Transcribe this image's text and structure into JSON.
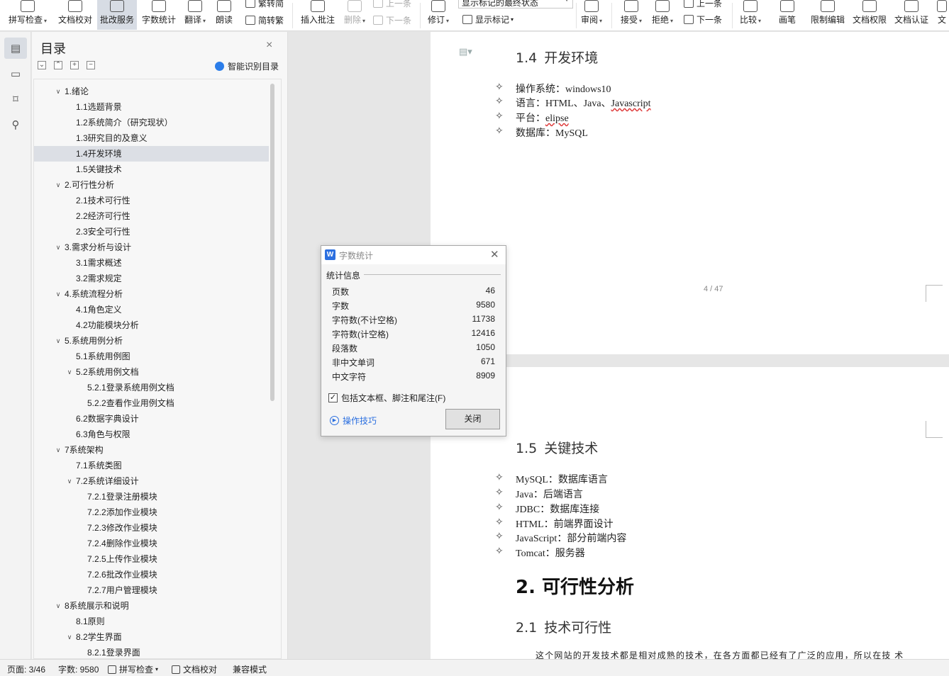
{
  "ribbon": {
    "buttons": [
      {
        "label": "拼写检查",
        "caret": "▾"
      },
      {
        "label": "文档校对",
        "caret": ""
      },
      {
        "label": "批改服务",
        "caret": ""
      },
      {
        "label": "字数统计",
        "caret": ""
      },
      {
        "label": "翻译",
        "caret": "▾"
      },
      {
        "label": "朗读",
        "caret": ""
      },
      {
        "label": "插入批注",
        "caret": ""
      },
      {
        "label": "删除",
        "caret": "▾"
      },
      {
        "label": "修订",
        "caret": "▾"
      },
      {
        "label": "审阅",
        "caret": "▾"
      },
      {
        "label": "接受",
        "caret": "▾"
      },
      {
        "label": "拒绝",
        "caret": "▾"
      },
      {
        "label": "比较",
        "caret": "▾"
      },
      {
        "label": "画笔",
        "caret": ""
      },
      {
        "label": "限制编辑",
        "caret": ""
      },
      {
        "label": "文档权限",
        "caret": ""
      },
      {
        "label": "文档认证",
        "caret": ""
      },
      {
        "label": "文",
        "caret": ""
      }
    ],
    "trad_simplified": "繁转简",
    "simplified_trad": "简转繁",
    "prev_comment": "上一条",
    "next_comment": "下一条",
    "markup_state": "显示标记的最终状态",
    "show_markup": "显示标记",
    "prev_change": "上一条",
    "next_change": "下一条"
  },
  "sidebar_icons": [
    "outline-icon",
    "navigation-icon",
    "bookmark-icon",
    "search-icon"
  ],
  "toc": {
    "title": "目录",
    "close": "×",
    "smart": "智能识别目录",
    "items": [
      {
        "label": "1.绪论",
        "level": 1,
        "arrow": "v"
      },
      {
        "label": "1.1选题背景",
        "level": 2,
        "arrow": ""
      },
      {
        "label": "1.2系统简介（研究现状）",
        "level": 2,
        "arrow": ""
      },
      {
        "label": "1.3研究目的及意义",
        "level": 2,
        "arrow": ""
      },
      {
        "label": "1.4开发环境",
        "level": 2,
        "arrow": "",
        "selected": true
      },
      {
        "label": "1.5关键技术",
        "level": 2,
        "arrow": ""
      },
      {
        "label": "2.可行性分析",
        "level": 1,
        "arrow": "v"
      },
      {
        "label": "2.1技术可行性",
        "level": 2,
        "arrow": ""
      },
      {
        "label": "2.2经济可行性",
        "level": 2,
        "arrow": ""
      },
      {
        "label": "2.3安全可行性",
        "level": 2,
        "arrow": ""
      },
      {
        "label": "3.需求分析与设计",
        "level": 1,
        "arrow": "v"
      },
      {
        "label": "3.1需求概述",
        "level": 2,
        "arrow": ""
      },
      {
        "label": "3.2需求规定",
        "level": 2,
        "arrow": ""
      },
      {
        "label": "4.系统流程分析",
        "level": 1,
        "arrow": "v"
      },
      {
        "label": "4.1角色定义",
        "level": 2,
        "arrow": ""
      },
      {
        "label": "4.2功能模块分析",
        "level": 2,
        "arrow": ""
      },
      {
        "label": "5.系统用例分析",
        "level": 1,
        "arrow": "v"
      },
      {
        "label": "5.1系统用例图",
        "level": 2,
        "arrow": ""
      },
      {
        "label": "5.2系统用例文档",
        "level": 2,
        "arrow": "v"
      },
      {
        "label": "5.2.1登录系统用例文档",
        "level": 3,
        "arrow": ""
      },
      {
        "label": "5.2.2查看作业用例文档",
        "level": 3,
        "arrow": ""
      },
      {
        "label": "6.2数据字典设计",
        "level": 2,
        "arrow": ""
      },
      {
        "label": "6.3角色与权限",
        "level": 2,
        "arrow": ""
      },
      {
        "label": "7系统架构",
        "level": 1,
        "arrow": "v"
      },
      {
        "label": "7.1系统类图",
        "level": 2,
        "arrow": ""
      },
      {
        "label": "7.2系统详细设计",
        "level": 2,
        "arrow": "v"
      },
      {
        "label": "7.2.1登录注册模块",
        "level": 3,
        "arrow": ""
      },
      {
        "label": "7.2.2添加作业模块",
        "level": 3,
        "arrow": ""
      },
      {
        "label": "7.2.3修改作业模块",
        "level": 3,
        "arrow": ""
      },
      {
        "label": "7.2.4删除作业模块",
        "level": 3,
        "arrow": ""
      },
      {
        "label": "7.2.5上传作业模块",
        "level": 3,
        "arrow": ""
      },
      {
        "label": "7.2.6批改作业模块",
        "level": 3,
        "arrow": ""
      },
      {
        "label": "7.2.7用户管理模块",
        "level": 3,
        "arrow": ""
      },
      {
        "label": "8系统展示和说明",
        "level": 1,
        "arrow": "v"
      },
      {
        "label": "8.1原则",
        "level": 2,
        "arrow": ""
      },
      {
        "label": "8.2学生界面",
        "level": 2,
        "arrow": "v"
      },
      {
        "label": "8.2.1登录界面",
        "level": 3,
        "arrow": ""
      }
    ]
  },
  "page1": {
    "heading_num": "1.4",
    "heading_text": "开发环境",
    "bullets": [
      {
        "label": "操作系统",
        "value": "windows10",
        "wavy": ""
      },
      {
        "label": "语言",
        "value": "HTML、Java、",
        "wavy": "Javascript"
      },
      {
        "label": "平台",
        "value": "",
        "wavy": "elipse"
      },
      {
        "label": "数据库",
        "value": "MySQL",
        "wavy": ""
      }
    ],
    "page_num": "4 / 47"
  },
  "page2": {
    "heading_num": "1.5",
    "heading_text": "关键技术",
    "bullets": [
      {
        "label": "MySQL",
        "value": "数据库语言"
      },
      {
        "label": "Java",
        "value": "后端语言"
      },
      {
        "label": "JDBC",
        "value": "数据库连接"
      },
      {
        "label": "HTML",
        "value": "前端界面设计"
      },
      {
        "label": "JavaScript",
        "value": "部分前端内容"
      },
      {
        "label": "Tomcat",
        "value": "服务器"
      }
    ],
    "h1": "2. 可行性分析",
    "h2_num": "2.1",
    "h2_text": "技术可行性",
    "para": "这个网站的开发技术都是相对成熟的技术，在各方面都已经有了广泛的应用，所以在技   术"
  },
  "bullet_symbol": "✧",
  "colon": "：",
  "dialog": {
    "logo": "W",
    "title": "字数统计",
    "section": "统计信息",
    "rows": [
      {
        "label": "页数",
        "value": "46"
      },
      {
        "label": "字数",
        "value": "9580"
      },
      {
        "label": "字符数(不计空格)",
        "value": "11738"
      },
      {
        "label": "字符数(计空格)",
        "value": "12416"
      },
      {
        "label": "段落数",
        "value": "1050"
      },
      {
        "label": "非中文单词",
        "value": "671"
      },
      {
        "label": "中文字符",
        "value": "8909"
      }
    ],
    "checkbox_label": "包括文本框、脚注和尾注(F)",
    "checkbox_checked": true,
    "tips": "操作技巧",
    "close_button": "关闭"
  },
  "status": {
    "page": "页面: 3/46",
    "words": "字数: 9580",
    "spell": "拼写检查",
    "proof": "文档校对",
    "compat": "兼容模式"
  }
}
